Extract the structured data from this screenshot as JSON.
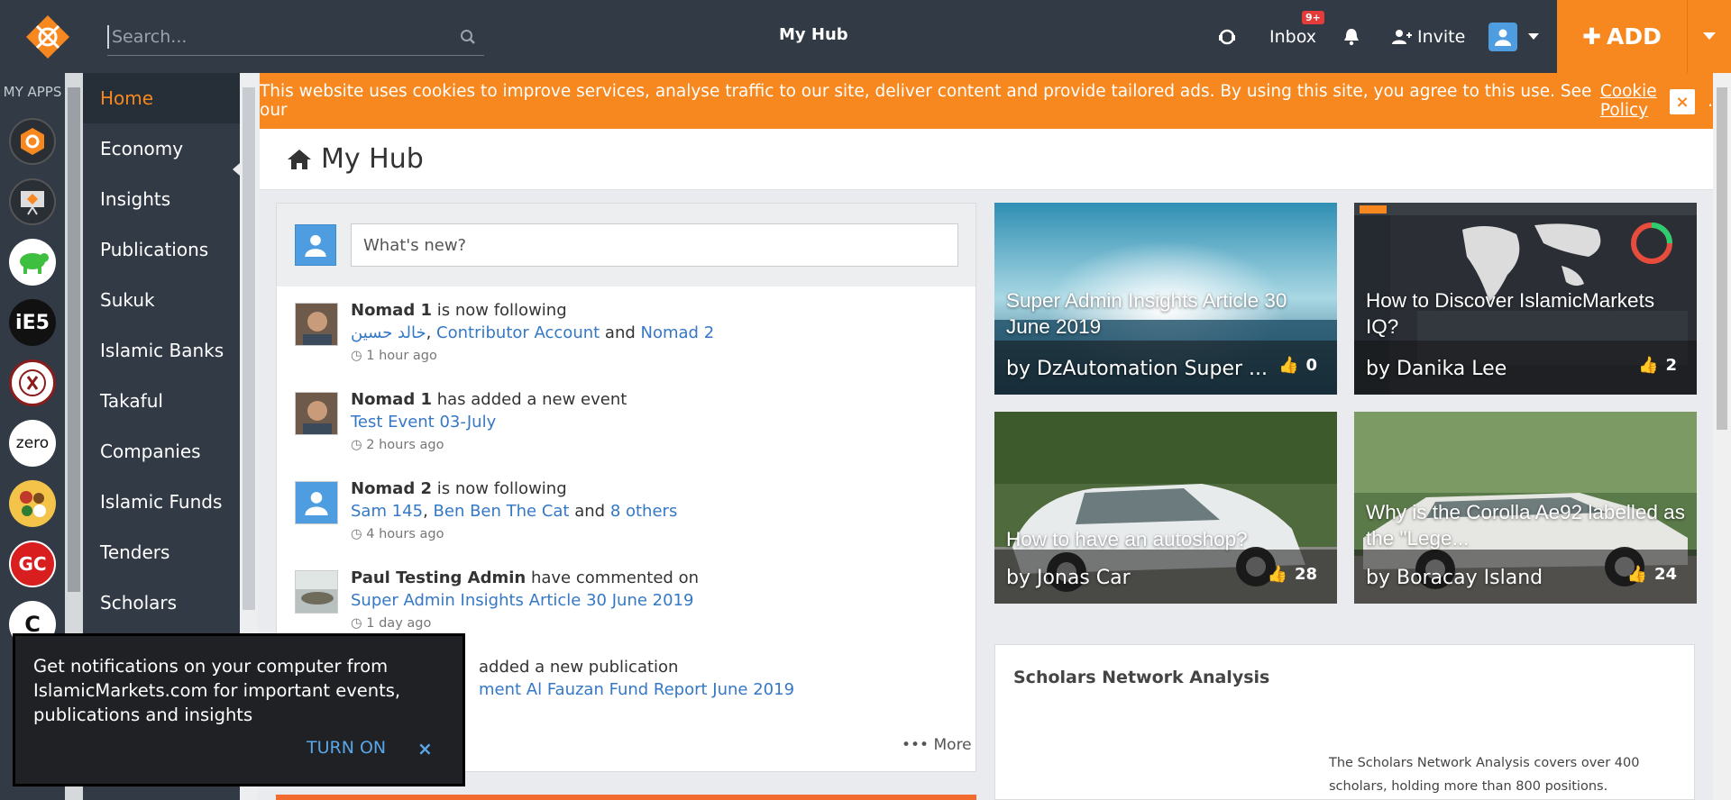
{
  "header": {
    "search_placeholder": "Search...",
    "title": "My Hub",
    "inbox_label": "Inbox",
    "inbox_badge": "9+",
    "invite_label": "Invite",
    "add_label": "ADD"
  },
  "apps": {
    "label": "MY APPS",
    "items": [
      {
        "name": "app-islamicmarkets",
        "text": ""
      },
      {
        "name": "app-presentation",
        "text": ""
      },
      {
        "name": "app-animal",
        "text": ""
      },
      {
        "name": "app-ie5",
        "text": "iE5"
      },
      {
        "name": "app-made-in-boracay",
        "text": ""
      },
      {
        "name": "app-zero",
        "text": "zero"
      },
      {
        "name": "app-food",
        "text": ""
      },
      {
        "name": "app-gc",
        "text": "GC"
      },
      {
        "name": "app-c",
        "text": "C"
      }
    ]
  },
  "nav": {
    "items": [
      {
        "label": "Home",
        "active": true
      },
      {
        "label": "Economy"
      },
      {
        "label": "Insights"
      },
      {
        "label": "Publications"
      },
      {
        "label": "Sukuk"
      },
      {
        "label": "Islamic Banks"
      },
      {
        "label": "Takaful"
      },
      {
        "label": "Companies"
      },
      {
        "label": "Islamic Funds"
      },
      {
        "label": "Tenders"
      },
      {
        "label": "Scholars"
      }
    ]
  },
  "cookie": {
    "text": "This website uses cookies to improve services, analyse traffic to our site, deliver content and provide tailored ads. By using this site, you agree to this use. See our",
    "link": "Cookie Policy",
    "close": "×"
  },
  "page": {
    "title": "My Hub"
  },
  "feed": {
    "placeholder": "What's new?",
    "activities": [
      {
        "actor": "Nomad 1",
        "action": " is now following",
        "links": [
          "خالد حسين",
          "Contributor Account",
          "Nomad 2"
        ],
        "time": "1 hour ago"
      },
      {
        "actor": "Nomad 1",
        "action": " has added a new event",
        "links": [
          "Test Event 03-July"
        ],
        "time": "2 hours ago"
      },
      {
        "actor": "Nomad 2",
        "action": " is now following",
        "links": [
          "Sam 145",
          "Ben Ben The Cat",
          "8 others"
        ],
        "time": "4 hours ago"
      },
      {
        "actor": "Paul Testing Admin",
        "action": " have commented on",
        "links": [
          "Super Admin Insights Article 30 June 2019"
        ],
        "time": "1 day ago"
      },
      {
        "actor": "",
        "action": "added a new publication",
        "links": [
          "ment Al Fauzan Fund Report June 2019"
        ],
        "time": ""
      }
    ],
    "more": "More",
    "sep_comma": ", ",
    "sep_and": " and "
  },
  "cards": [
    {
      "title": "Super Admin Insights Article 30 June 2019",
      "author": "by DzAutomation Super ...",
      "likes": "0"
    },
    {
      "title": "How to Discover IslamicMarkets IQ?",
      "author": "by Danika Lee",
      "likes": "2"
    },
    {
      "title": "How to have an autoshop?",
      "author": "by Jonas Car",
      "likes": "28"
    },
    {
      "title": "Why is the Corolla Ae92 labelled as the \"Lege...",
      "author": "by Boracay Island",
      "likes": "24"
    }
  ],
  "scholars": {
    "title": "Scholars Network Analysis",
    "text": "The Scholars Network Analysis covers over 400 scholars, holding more than 800 positions."
  },
  "notification": {
    "message": "Get notifications on your computer from IslamicMarkets.com for important events, publications and insights",
    "turn_on": "TURN ON",
    "close": "×"
  },
  "colors": {
    "accent": "#f7881f",
    "dark": "#313a45",
    "link": "#3478c6"
  }
}
